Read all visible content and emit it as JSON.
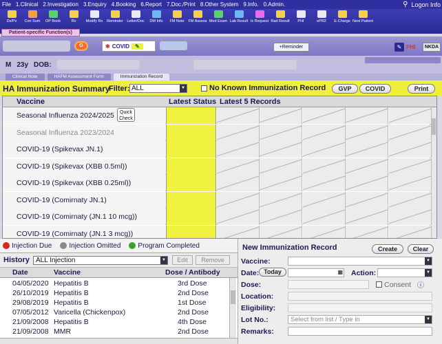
{
  "menu": {
    "items": [
      "File",
      "1.Clinical",
      "2.Investigation",
      "3.Enquiry",
      "4.Booking",
      "6.Report",
      "7.Doc./Print",
      "8.Other System",
      "9.Info.",
      "0.Admin."
    ],
    "logon": "Logon Info"
  },
  "toolbar": [
    "Dx/Px",
    "Con Sum",
    "OP Book",
    "Rx",
    "Modify Rx",
    "Reminder",
    "Letter/Doc",
    "DM Info",
    "FM Note",
    "FM Assess",
    "Med Exam",
    "Lab Result",
    "Ix Request",
    "Rad Result",
    "PHI",
    "ePR2",
    "E-Charge",
    "Next Patient"
  ],
  "patient_function_tab": "Patient-specific Function(s)",
  "patient_band": {
    "covid_tag": "COVID",
    "reminder_button": "+Reminder",
    "phi": "PHI",
    "nkda": "NKDA"
  },
  "patient": {
    "sex": "M",
    "age": "23y",
    "dob_label": "DOB:"
  },
  "doc_tabs": [
    "Clinical Note",
    "HAFM Assessment Form",
    "Immunization Record"
  ],
  "summary": {
    "title": "HA Immunization Summary",
    "filter_label": "Filter:",
    "filter_value": "ALL",
    "nkir_label": "No Known Immunization Record",
    "buttons": {
      "gvp": "GVP",
      "covid": "COVID",
      "print": "Print"
    }
  },
  "grid": {
    "headers": {
      "vaccine": "Vaccine",
      "latest_status": "Latest Status",
      "latest_records": "Latest 5 Records"
    },
    "quick_check": "Quick Check",
    "rows": [
      "Seasonal Influenza 2024/2025",
      "Seasonal Influenza 2023/2024",
      "COVID-19 (Spikevax JN.1)",
      "COVID-19 (Spikevax (XBB 0.5ml))",
      "COVID-19 (Spikevax (XBB 0.25ml))",
      "COVID-19 (Comirnaty JN.1)",
      "COVID-19 (Comirnaty (JN.1 10 mcg))",
      "COVID-19 (Comirnaty (JN.1 3 mcg))"
    ]
  },
  "legend": {
    "due": "Injection Due",
    "omitted": "Injection Omitted",
    "completed": "Program Completed",
    "colors": {
      "due": "#d42a1a",
      "omitted": "#8a8a8a",
      "completed": "#3aa32a"
    }
  },
  "history": {
    "label": "History",
    "select_value": "ALL Injection",
    "edit": "Edit",
    "remove": "Remove",
    "headers": {
      "date": "Date",
      "vaccine": "Vaccine",
      "dose": "Dose / Antibody"
    },
    "rows": [
      {
        "date": "04/05/2020",
        "vaccine": "Hepatitis B",
        "dose": "3rd Dose"
      },
      {
        "date": "26/10/2019",
        "vaccine": "Hepatitis B",
        "dose": "2nd Dose"
      },
      {
        "date": "29/08/2019",
        "vaccine": "Hepatitis B",
        "dose": "1st Dose"
      },
      {
        "date": "07/05/2012",
        "vaccine": "Varicella (Chickenpox)",
        "dose": "2nd Dose"
      },
      {
        "date": "21/09/2008",
        "vaccine": "Hepatitis B",
        "dose": "4th Dose"
      },
      {
        "date": "21/09/2008",
        "vaccine": "MMR",
        "dose": "2nd Dose"
      }
    ]
  },
  "new_record": {
    "title": "New Immunization Record",
    "create": "Create",
    "clear": "Clear",
    "vaccine": "Vaccine:",
    "date": "Date:",
    "today": "Today",
    "action": "Action:",
    "dose": "Dose:",
    "consent": "Consent",
    "location": "Location:",
    "eligibility": "Eligibility:",
    "lot_no": "Lot No.:",
    "lot_placeholder": "Select from list / Type in",
    "remarks": "Remarks:"
  }
}
